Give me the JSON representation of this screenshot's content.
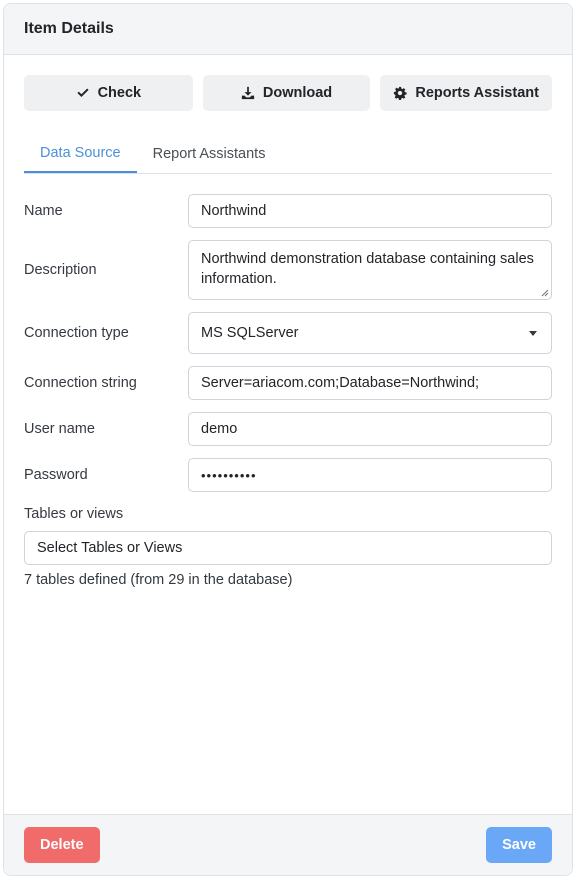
{
  "header": {
    "title": "Item Details"
  },
  "toolbar": {
    "check_label": "Check",
    "download_label": "Download",
    "reports_assistant_label": "Reports Assistant"
  },
  "tabs": [
    {
      "label": "Data Source",
      "active": true
    },
    {
      "label": "Report Assistants",
      "active": false
    }
  ],
  "form": {
    "name_label": "Name",
    "name_value": "Northwind",
    "description_label": "Description",
    "description_value": "Northwind demonstration database containing sales information.",
    "connection_type_label": "Connection type",
    "connection_type_value": "MS SQLServer",
    "connection_string_label": "Connection string",
    "connection_string_value": "Server=ariacom.com;Database=Northwind;",
    "user_name_label": "User name",
    "user_name_value": "demo",
    "password_label": "Password",
    "password_value": "••••••••••",
    "tables_label": "Tables or views",
    "tables_select_label": "Select Tables or Views",
    "tables_info": "7 tables defined (from 29 in the database)"
  },
  "footer": {
    "delete_label": "Delete",
    "save_label": "Save"
  },
  "colors": {
    "accent": "#4a90d9",
    "delete": "#f26b6b",
    "save": "#6aa8f7"
  },
  "icons": {
    "check": "check-icon",
    "download": "download-icon",
    "reports_assistant": "gear-icon"
  }
}
